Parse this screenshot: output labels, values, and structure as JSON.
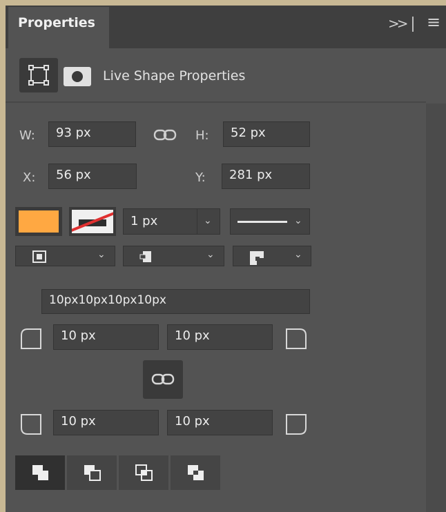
{
  "panel": {
    "tab_label": "Properties",
    "collapse_label": ">>",
    "section_title": "Live Shape Properties"
  },
  "dims": {
    "w_label": "W:",
    "w_value": "93 px",
    "h_label": "H:",
    "h_value": "52 px",
    "x_label": "X:",
    "x_value": "56 px",
    "y_label": "Y:",
    "y_value": "281 px"
  },
  "appearance": {
    "fill_color": "#ffa842",
    "stroke_width": "1 px",
    "stroke_style": "solid"
  },
  "corners": {
    "combined": "10px10px10px10px",
    "top_left": "10 px",
    "top_right": "10 px",
    "bottom_left": "10 px",
    "bottom_right": "10 px"
  },
  "pathops": [
    "combine-shapes",
    "subtract-front-shape",
    "intersect-shape-areas",
    "exclude-overlapping-shapes"
  ]
}
